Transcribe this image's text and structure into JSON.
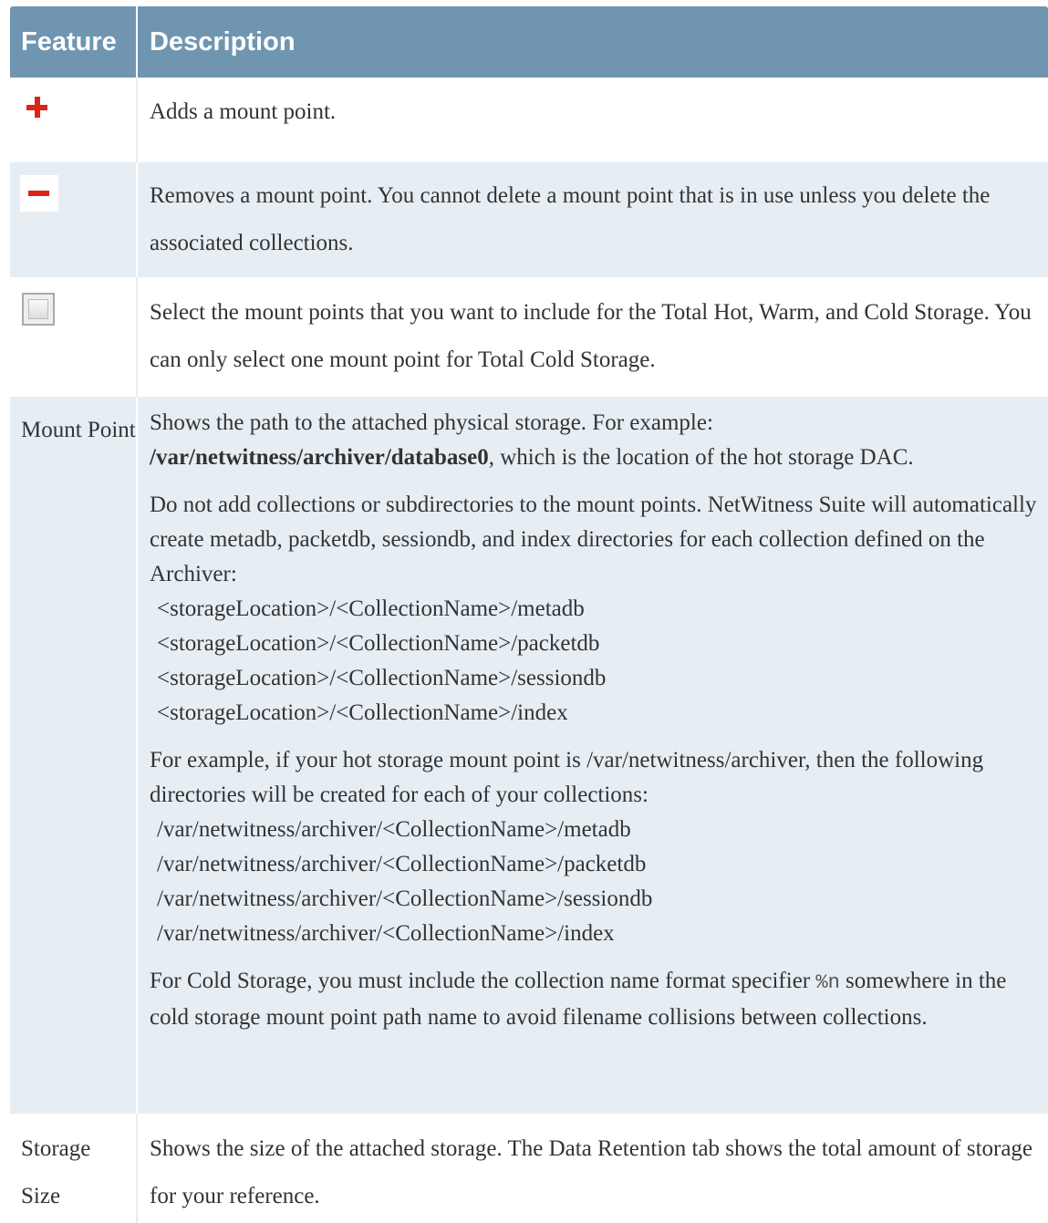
{
  "header": {
    "feature": "Feature",
    "description": "Description"
  },
  "rows": {
    "add": {
      "icon": "plus-icon",
      "description": "Adds a mount point."
    },
    "remove": {
      "icon": "minus-icon",
      "description": "Removes a mount point. You cannot delete a mount point that is in use unless you delete the associated collections."
    },
    "select": {
      "icon": "checkbox-icon",
      "description": "Select the mount points that you want to include for the Total Hot, Warm, and Cold Storage. You can only select one mount point for Total Cold Storage."
    },
    "mount_point": {
      "feature": "Mount Point",
      "p1_pre": "Shows the path to the attached physical storage. For example:",
      "p1_bold": "/var/netwitness/archiver/database0",
      "p1_post": ", which is the location of the hot storage DAC.",
      "p2": "Do not add collections or subdirectories to the mount points. NetWitness Suite will automatically create metadb, packetdb, sessiondb, and index directories for each collection defined on the Archiver:",
      "p2_paths": [
        "<storageLocation>/<CollectionName>/metadb",
        "<storageLocation>/<CollectionName>/packetdb",
        "<storageLocation>/<CollectionName>/sessiondb",
        "<storageLocation>/<CollectionName>/index"
      ],
      "p3": "For example, if your hot storage mount point is /var/netwitness/archiver, then the following directories will be created for each of your collections:",
      "p3_paths": [
        "/var/netwitness/archiver/<CollectionName>/metadb",
        "/var/netwitness/archiver/<CollectionName>/packetdb",
        "/var/netwitness/archiver/<CollectionName>/sessiondb",
        "/var/netwitness/archiver/<CollectionName>/index"
      ],
      "p4_pre": "For Cold Storage, you must include the collection name format specifier",
      "p4_code": "%n",
      "p4_post": "somewhere in the cold storage mount point path name to avoid filename collisions between collections."
    },
    "storage_size": {
      "feature_line1": "Storage",
      "feature_line2": "Size",
      "description": "Shows the size of the attached storage. The Data Retention tab shows the total amount of storage for your reference."
    }
  }
}
